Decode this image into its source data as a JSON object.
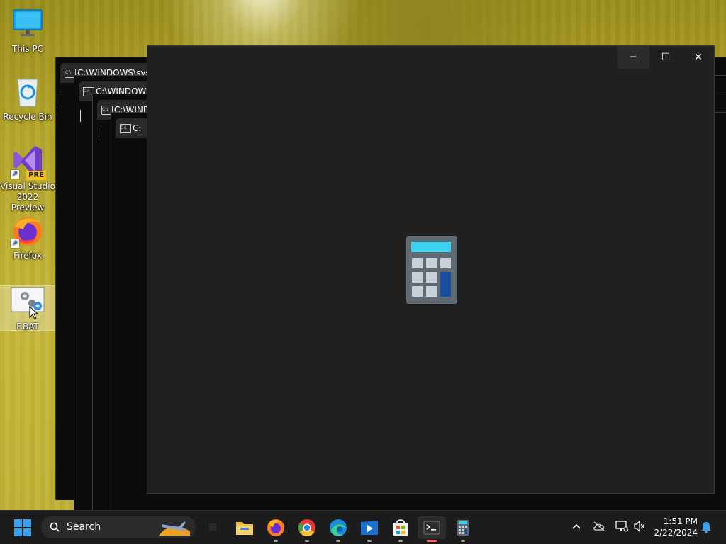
{
  "desktop": {
    "icons": [
      {
        "label": "This PC"
      },
      {
        "label": "Recycle Bin"
      },
      {
        "label": "Visual Studio 2022 Preview",
        "badge": "PRE"
      },
      {
        "label": "Firefox"
      },
      {
        "label": "F.BAT"
      }
    ]
  },
  "cmd_windows": [
    {
      "title": "C:\\WINDOWS\\sys"
    },
    {
      "title": "C:\\WINDOWS\\"
    },
    {
      "title": "C:\\WINDO"
    },
    {
      "title": "C:"
    }
  ],
  "calculator": {
    "minimize_glyph": "─",
    "maximize_glyph": "☐",
    "close_glyph": "✕",
    "colors": {
      "bg": "#202020",
      "display": "#3fd0f0",
      "key": "#c8d0d8",
      "accent": "#1a4fa0",
      "body": "#5f6a72"
    }
  },
  "taskbar": {
    "search_placeholder": "Search",
    "clock_time": "1:51 PM",
    "clock_date": "2/22/2024",
    "apps": [
      "file-explorer",
      "firefox",
      "chrome",
      "edge",
      "media-player",
      "microsoft-store",
      "terminal",
      "calculator"
    ]
  }
}
